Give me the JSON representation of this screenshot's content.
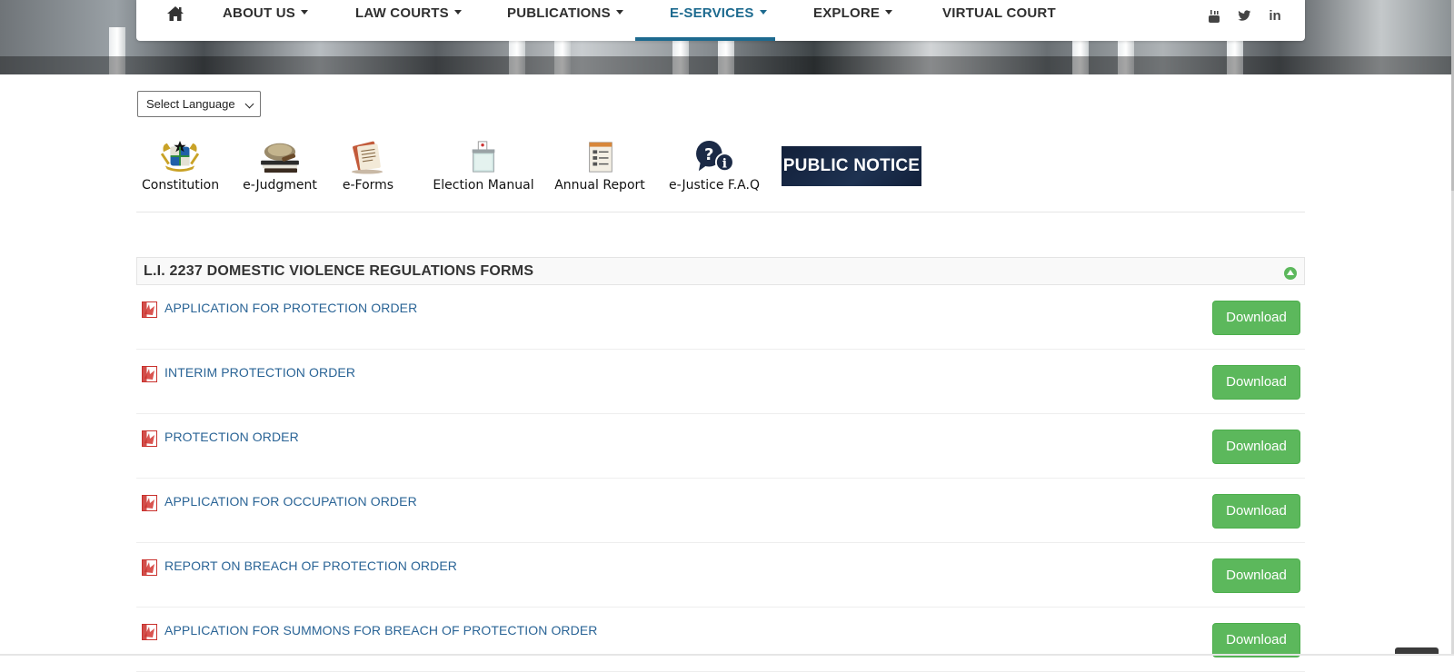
{
  "nav": {
    "items": [
      {
        "label": "ABOUT US",
        "has_caret": true
      },
      {
        "label": "LAW COURTS",
        "has_caret": true
      },
      {
        "label": "PUBLICATIONS",
        "has_caret": true
      },
      {
        "label": "E-SERVICES",
        "has_caret": true,
        "active": true
      },
      {
        "label": "EXPLORE",
        "has_caret": true
      },
      {
        "label": "VIRTUAL COURT",
        "has_caret": false
      }
    ],
    "home_icon": "home-icon",
    "social": [
      "youtube-icon",
      "twitter-icon",
      "linkedin-icon"
    ],
    "linkedin_text": "in",
    "active_color": "#1d6a8f"
  },
  "language_select": {
    "value": "Select Language"
  },
  "quick_links": [
    {
      "label": "Constitution",
      "icon": "coat-of-arms-icon"
    },
    {
      "label": "e-Judgment",
      "icon": "gavel-books-icon"
    },
    {
      "label": "e-Forms",
      "icon": "forms-icon"
    },
    {
      "label": "Election Manual",
      "icon": "ballot-box-icon"
    },
    {
      "label": "Annual Report",
      "icon": "report-icon"
    },
    {
      "label": "e-Justice F.A.Q",
      "icon": "faq-icon"
    }
  ],
  "public_notice": {
    "label": "PUBLIC NOTICE"
  },
  "panel": {
    "title": "L.I. 2237 DOMESTIC VIOLENCE REGULATIONS FORMS",
    "rows": [
      {
        "label": "APPLICATION FOR PROTECTION ORDER",
        "button": "Download"
      },
      {
        "label": "INTERIM PROTECTION ORDER",
        "button": "Download"
      },
      {
        "label": "PROTECTION ORDER",
        "button": "Download"
      },
      {
        "label": "APPLICATION FOR OCCUPATION ORDER",
        "button": "Download"
      },
      {
        "label": "REPORT ON BREACH OF PROTECTION ORDER",
        "button": "Download"
      },
      {
        "label": "APPLICATION FOR SUMMONS FOR BREACH OF PROTECTION ORDER",
        "button": "Download"
      }
    ]
  },
  "colors": {
    "download_green": "#5cb85c",
    "link_blue": "#2a6496",
    "notice_navy": "#16243a"
  }
}
